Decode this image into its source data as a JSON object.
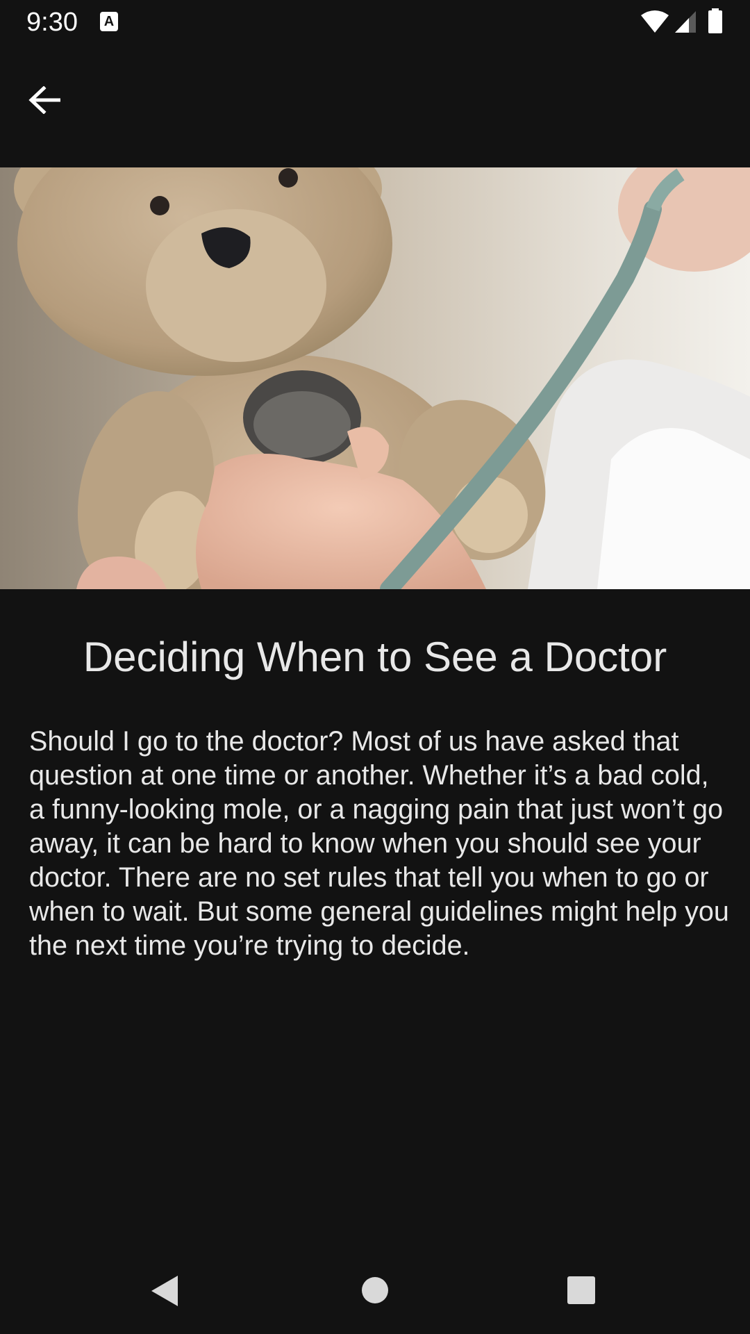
{
  "status_bar": {
    "time": "9:30",
    "icons": [
      "text-a-notification-icon",
      "wifi-icon",
      "cell-signal-icon",
      "battery-icon"
    ]
  },
  "app_bar": {
    "back_icon": "arrow-back-icon"
  },
  "hero": {
    "subject": "teddy-bear-stethoscope-photo"
  },
  "article": {
    "title": "Deciding When to See a Doctor",
    "body": "Should I go to the doctor? Most of us have asked that question at one time or another. Whether it’s a bad cold, a funny-looking mole, or a nagging pain that just won’t go away, it can be hard to know when you should see your doctor. There are no set rules that tell you when to go or when to wait. But some general guidelines might help you the next time you’re trying to decide."
  },
  "nav_bar": {
    "icons": [
      "nav-back-icon",
      "nav-home-icon",
      "nav-recents-icon"
    ]
  },
  "colors": {
    "background": "#121212",
    "text": "#e8e8e8",
    "icon": "#ffffff"
  }
}
